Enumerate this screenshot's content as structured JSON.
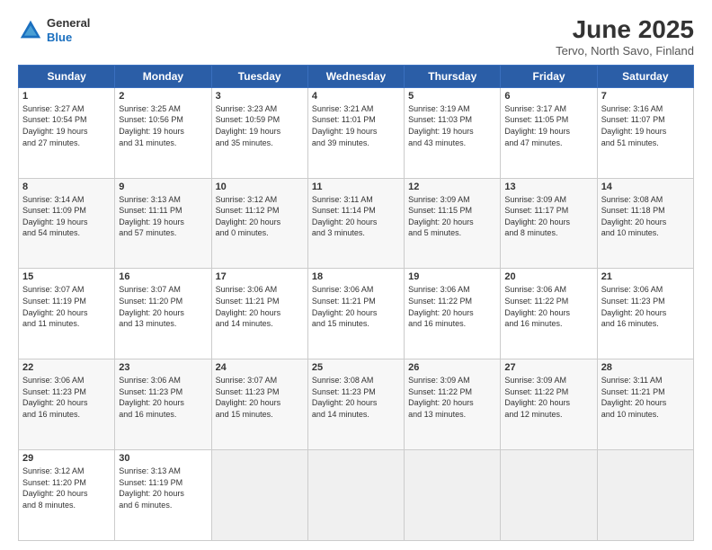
{
  "logo": {
    "line1": "General",
    "line2": "Blue"
  },
  "title": "June 2025",
  "subtitle": "Tervo, North Savo, Finland",
  "days_header": [
    "Sunday",
    "Monday",
    "Tuesday",
    "Wednesday",
    "Thursday",
    "Friday",
    "Saturday"
  ],
  "weeks": [
    [
      {
        "day": "1",
        "info": "Sunrise: 3:27 AM\nSunset: 10:54 PM\nDaylight: 19 hours\nand 27 minutes."
      },
      {
        "day": "2",
        "info": "Sunrise: 3:25 AM\nSunset: 10:56 PM\nDaylight: 19 hours\nand 31 minutes."
      },
      {
        "day": "3",
        "info": "Sunrise: 3:23 AM\nSunset: 10:59 PM\nDaylight: 19 hours\nand 35 minutes."
      },
      {
        "day": "4",
        "info": "Sunrise: 3:21 AM\nSunset: 11:01 PM\nDaylight: 19 hours\nand 39 minutes."
      },
      {
        "day": "5",
        "info": "Sunrise: 3:19 AM\nSunset: 11:03 PM\nDaylight: 19 hours\nand 43 minutes."
      },
      {
        "day": "6",
        "info": "Sunrise: 3:17 AM\nSunset: 11:05 PM\nDaylight: 19 hours\nand 47 minutes."
      },
      {
        "day": "7",
        "info": "Sunrise: 3:16 AM\nSunset: 11:07 PM\nDaylight: 19 hours\nand 51 minutes."
      }
    ],
    [
      {
        "day": "8",
        "info": "Sunrise: 3:14 AM\nSunset: 11:09 PM\nDaylight: 19 hours\nand 54 minutes."
      },
      {
        "day": "9",
        "info": "Sunrise: 3:13 AM\nSunset: 11:11 PM\nDaylight: 19 hours\nand 57 minutes."
      },
      {
        "day": "10",
        "info": "Sunrise: 3:12 AM\nSunset: 11:12 PM\nDaylight: 20 hours\nand 0 minutes."
      },
      {
        "day": "11",
        "info": "Sunrise: 3:11 AM\nSunset: 11:14 PM\nDaylight: 20 hours\nand 3 minutes."
      },
      {
        "day": "12",
        "info": "Sunrise: 3:09 AM\nSunset: 11:15 PM\nDaylight: 20 hours\nand 5 minutes."
      },
      {
        "day": "13",
        "info": "Sunrise: 3:09 AM\nSunset: 11:17 PM\nDaylight: 20 hours\nand 8 minutes."
      },
      {
        "day": "14",
        "info": "Sunrise: 3:08 AM\nSunset: 11:18 PM\nDaylight: 20 hours\nand 10 minutes."
      }
    ],
    [
      {
        "day": "15",
        "info": "Sunrise: 3:07 AM\nSunset: 11:19 PM\nDaylight: 20 hours\nand 11 minutes."
      },
      {
        "day": "16",
        "info": "Sunrise: 3:07 AM\nSunset: 11:20 PM\nDaylight: 20 hours\nand 13 minutes."
      },
      {
        "day": "17",
        "info": "Sunrise: 3:06 AM\nSunset: 11:21 PM\nDaylight: 20 hours\nand 14 minutes."
      },
      {
        "day": "18",
        "info": "Sunrise: 3:06 AM\nSunset: 11:21 PM\nDaylight: 20 hours\nand 15 minutes."
      },
      {
        "day": "19",
        "info": "Sunrise: 3:06 AM\nSunset: 11:22 PM\nDaylight: 20 hours\nand 16 minutes."
      },
      {
        "day": "20",
        "info": "Sunrise: 3:06 AM\nSunset: 11:22 PM\nDaylight: 20 hours\nand 16 minutes."
      },
      {
        "day": "21",
        "info": "Sunrise: 3:06 AM\nSunset: 11:23 PM\nDaylight: 20 hours\nand 16 minutes."
      }
    ],
    [
      {
        "day": "22",
        "info": "Sunrise: 3:06 AM\nSunset: 11:23 PM\nDaylight: 20 hours\nand 16 minutes."
      },
      {
        "day": "23",
        "info": "Sunrise: 3:06 AM\nSunset: 11:23 PM\nDaylight: 20 hours\nand 16 minutes."
      },
      {
        "day": "24",
        "info": "Sunrise: 3:07 AM\nSunset: 11:23 PM\nDaylight: 20 hours\nand 15 minutes."
      },
      {
        "day": "25",
        "info": "Sunrise: 3:08 AM\nSunset: 11:23 PM\nDaylight: 20 hours\nand 14 minutes."
      },
      {
        "day": "26",
        "info": "Sunrise: 3:09 AM\nSunset: 11:22 PM\nDaylight: 20 hours\nand 13 minutes."
      },
      {
        "day": "27",
        "info": "Sunrise: 3:09 AM\nSunset: 11:22 PM\nDaylight: 20 hours\nand 12 minutes."
      },
      {
        "day": "28",
        "info": "Sunrise: 3:11 AM\nSunset: 11:21 PM\nDaylight: 20 hours\nand 10 minutes."
      }
    ],
    [
      {
        "day": "29",
        "info": "Sunrise: 3:12 AM\nSunset: 11:20 PM\nDaylight: 20 hours\nand 8 minutes."
      },
      {
        "day": "30",
        "info": "Sunrise: 3:13 AM\nSunset: 11:19 PM\nDaylight: 20 hours\nand 6 minutes."
      },
      {
        "day": "",
        "info": ""
      },
      {
        "day": "",
        "info": ""
      },
      {
        "day": "",
        "info": ""
      },
      {
        "day": "",
        "info": ""
      },
      {
        "day": "",
        "info": ""
      }
    ]
  ]
}
